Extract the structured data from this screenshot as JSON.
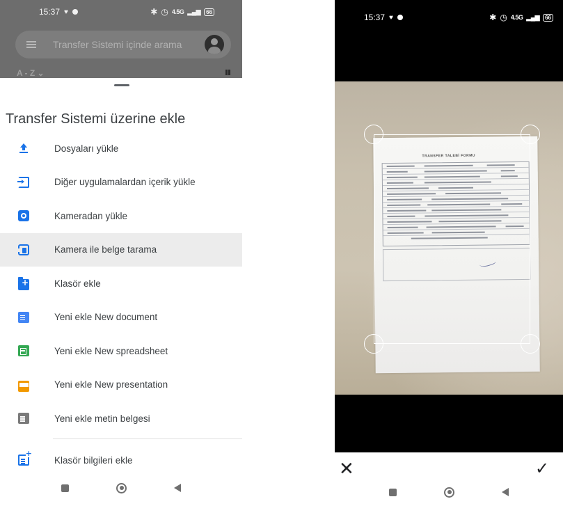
{
  "left_screen": {
    "status_bar": {
      "time": "15:37",
      "battery": "66",
      "network": "4.5G"
    },
    "search": {
      "placeholder": "Transfer Sistemi içinde arama"
    },
    "sort_label": "A - Z ⌄",
    "sheet": {
      "title": "Transfer Sistemi üzerine ekle",
      "items": [
        {
          "label": "Dosyaları yükle",
          "icon": "upload-icon"
        },
        {
          "label": "Diğer uygulamalardan içerik yükle",
          "icon": "import-icon"
        },
        {
          "label": "Kameradan yükle",
          "icon": "camera-icon"
        },
        {
          "label": "Kamera ile belge tarama",
          "icon": "scan-document-icon",
          "highlighted": true
        },
        {
          "label": "Klasör ekle",
          "icon": "new-folder-icon"
        },
        {
          "label": "Yeni ekle New document",
          "icon": "docs-icon"
        },
        {
          "label": "Yeni ekle New spreadsheet",
          "icon": "sheets-icon"
        },
        {
          "label": "Yeni ekle New presentation",
          "icon": "slides-icon"
        },
        {
          "label": "Yeni ekle metin belgesi",
          "icon": "text-document-icon"
        }
      ],
      "footer_item": {
        "label": "Klasör bilgileri ekle",
        "icon": "folder-info-icon"
      }
    }
  },
  "right_screen": {
    "status_bar": {
      "time": "15:37",
      "battery": "66",
      "network": "4.5G"
    },
    "document": {
      "title": "TRANSFER TALEBİ FORMU"
    },
    "cancel_symbol": "✕",
    "confirm_symbol": "✓"
  },
  "colors": {
    "accent_blue": "#1a73e8",
    "docs_blue": "#4285f4",
    "sheets_green": "#34a853",
    "slides_orange": "#f29900",
    "highlight_bg": "#ececec"
  }
}
